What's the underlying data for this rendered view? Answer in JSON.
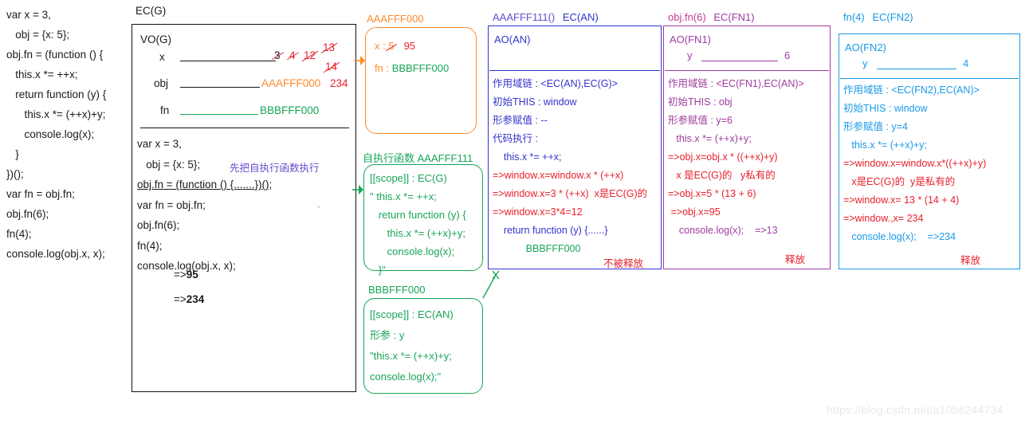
{
  "source_code": {
    "lines": [
      "var x = 3,",
      "   obj = {x: 5};",
      "obj.fn = (function () {",
      "   this.x *= ++x;",
      "   return function (y) {",
      "      this.x *= (++x)+y;",
      "      console.log(x);",
      "   }",
      "})();",
      "var fn = obj.fn;",
      "obj.fn(6);",
      "fn(4);",
      "console.log(obj.x, x);"
    ]
  },
  "ecg": {
    "label": "EC(G)",
    "vo_title": "VO(G)",
    "rows": [
      {
        "key": "x",
        "values": [
          "3",
          "4",
          "12",
          "13",
          "14"
        ]
      },
      {
        "key": "obj",
        "value": "AAAFFF000",
        "extra": "234"
      },
      {
        "key": "fn",
        "value": "BBBFFF000"
      }
    ],
    "code_lines": [
      "var x = 3,",
      "   obj = {x: 5};",
      "obj.fn = (function () {.......})();",
      "var fn = obj.fn;",
      "obj.fn(6);",
      "fn(4);",
      "console.log(obj.x, x);"
    ],
    "iife_note": "先把自执行函数执行",
    "result1_arrow": "=>",
    "result1": "95",
    "result2_arrow": "=>",
    "result2": "234"
  },
  "aaa000": {
    "label": "AAAFFF000",
    "key_x": "x : ",
    "val_x_old": "5",
    "val_x_new": "95",
    "key_fn": "fn : ",
    "val_fn": "BBBFFF000"
  },
  "aaa111": {
    "label": "自执行函数 AAAFFF111",
    "lines": [
      "[[scope]] : EC(G)",
      "\" this.x *= ++x;",
      "   return function (y) {",
      "      this.x *= (++x)+y;",
      "      console.log(x);",
      "   }\""
    ]
  },
  "bbb000": {
    "label": "BBBFFF000",
    "lines": [
      "[[scope]] : EC(AN)",
      "形参 : y",
      "\"this.x *= (++x)+y;",
      "console.log(x);\""
    ]
  },
  "an": {
    "label_call": "AAAFFF111()",
    "label_ec": "EC(AN)",
    "ao_title": "AO(AN)",
    "lines": [
      {
        "text": "作用域链 : <EC(AN),EC(G)>",
        "color": "blue"
      },
      {
        "text": "初始THIS : window",
        "color": "blue"
      },
      {
        "text": "形参赋值 : --",
        "color": "blue"
      },
      {
        "text": "代码执行 :",
        "color": "blue"
      },
      {
        "text": "    this.x *= ++x;",
        "color": "blue"
      },
      {
        "text": "=>window.x=window.x * (++x)",
        "color": "red"
      },
      {
        "text": "=>window.x=3 * (++x)  x是EC(G)的",
        "color": "red"
      },
      {
        "text": "=>window.x=3*4=12",
        "color": "red"
      },
      {
        "text": "    return function (y) {......}",
        "color": "blue"
      },
      {
        "text": "            BBBFFF000",
        "color": "green"
      }
    ],
    "not_freed": "不被释放"
  },
  "fn1": {
    "label_call": "obj.fn(6)",
    "label_ec": "EC(FN1)",
    "ao_title": "AO(FN1)",
    "param_key": "y",
    "param_val": "6",
    "lines": [
      {
        "text": "作用域链 : <EC(FN1),EC(AN)>",
        "color": "purple"
      },
      {
        "text": "初始THIS : obj",
        "color": "purple"
      },
      {
        "text": "形参赋值 : y=6",
        "color": "purple"
      },
      {
        "text": "   this.x *= (++x)+y;",
        "color": "purple"
      },
      {
        "text": "=>obj.x=obj.x * ((++x)+y)",
        "color": "red"
      },
      {
        "text": "   x 是EC(G)的   y私有的",
        "color": "red"
      },
      {
        "text": "=>obj.x=5 * (13 + 6)",
        "color": "red"
      },
      {
        "text": " =>obj.x=95",
        "color": "red"
      },
      {
        "text": "    console.log(x);    =>13",
        "color": "purple"
      }
    ],
    "console_result": "=>13",
    "freed": "释放"
  },
  "fn2": {
    "label_call": "fn(4)",
    "label_ec": "EC(FN2)",
    "ao_title": "AO(FN2)",
    "param_key": "y",
    "param_val": "4",
    "lines": [
      {
        "text": "作用域链 : <EC(FN2),EC(AN)>",
        "color": "cyan"
      },
      {
        "text": "初始THIS : window",
        "color": "cyan"
      },
      {
        "text": "形参赋值 : y=4",
        "color": "cyan"
      },
      {
        "text": "   this.x *= (++x)+y;",
        "color": "cyan"
      },
      {
        "text": "=>window.x=window.x*((++x)+y)",
        "color": "red"
      },
      {
        "text": "   x是EC(G)的  y是私有的",
        "color": "red"
      },
      {
        "text": "=>window.x= 13 * (14 + 4)",
        "color": "red"
      },
      {
        "text": "=>window.,x= 234",
        "color": "red"
      },
      {
        "text": "   console.log(x);    =>234",
        "color": "cyan"
      }
    ],
    "console_result": "=>234",
    "freed": "释放"
  },
  "watermark": "https://blog.csdn.net/a1056244734",
  "colors": {
    "red": "#e8212d",
    "orange": "#ff8a2b",
    "green": "#18a558",
    "blue": "#3333cc",
    "cyan": "#1a9ae8",
    "purple": "#a03ca0",
    "violet": "#6a4ad0"
  }
}
